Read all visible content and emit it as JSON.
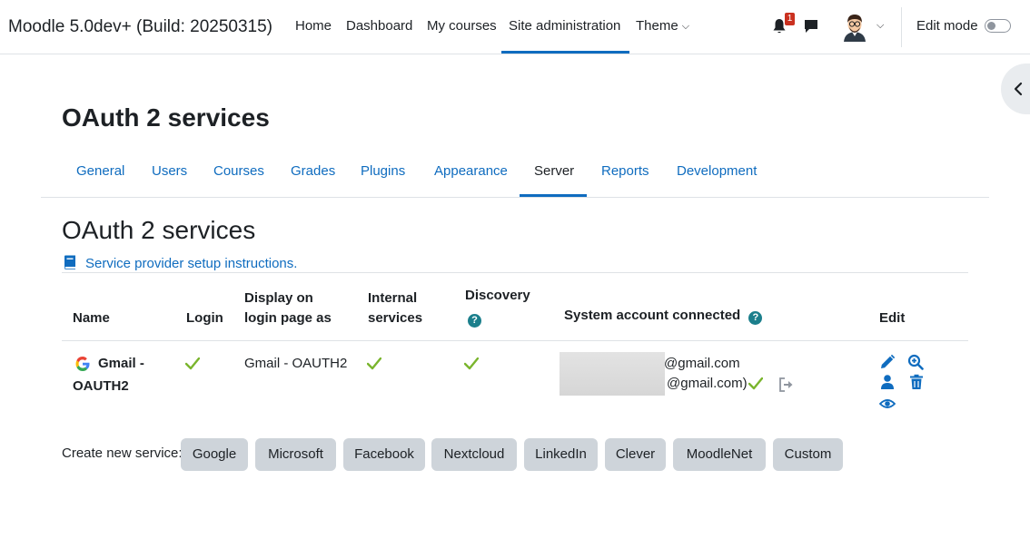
{
  "navbar": {
    "brand": "Moodle 5.0dev+ (Build: 20250315)",
    "links": [
      "Home",
      "Dashboard",
      "My courses",
      "Site administration",
      "Theme"
    ],
    "notification_count": "1",
    "edit_mode_label": "Edit mode",
    "edit_mode_on": false
  },
  "page": {
    "title": "OAuth 2 services",
    "tabs": [
      "General",
      "Users",
      "Courses",
      "Grades",
      "Plugins",
      "Appearance",
      "Server",
      "Reports",
      "Development"
    ],
    "active_tab": "Server",
    "section_title": "OAuth 2 services",
    "help_link": "Service provider setup instructions."
  },
  "table": {
    "headers": {
      "name": "Name",
      "login": "Login",
      "display_line1": "Display on",
      "display_line2": "login page as",
      "internal_line1": "Internal",
      "internal_line2": "services",
      "discovery": "Discovery",
      "system_account": "System account connected",
      "edit": "Edit"
    },
    "rows": [
      {
        "name_line1": "Gmail -",
        "name_line2": "OAUTH2",
        "login": true,
        "display_as": "Gmail - OAUTH2",
        "internal_services": true,
        "discovery": true,
        "account_line1": "@gmail.com",
        "account_line2": "@gmail.com)",
        "account_connected": true
      }
    ]
  },
  "create": {
    "label": "Create new service:",
    "buttons": [
      "Google",
      "Microsoft",
      "Facebook",
      "Nextcloud",
      "LinkedIn",
      "Clever",
      "MoodleNet",
      "Custom"
    ]
  },
  "colors": {
    "link": "#0f6cbf",
    "check": "#7ab52d",
    "info": "#1b7f8c",
    "badge": "#ca3120",
    "button_bg": "#ced4da"
  },
  "icons": {
    "notifications": "bell-icon",
    "messages": "chat-icon",
    "user_menu": "avatar",
    "drawer": "chevron-left-icon",
    "help": "book-icon",
    "provider": "google-icon",
    "edit": "pencil-icon",
    "review": "magnifier-plus-icon",
    "user_field_mappings": "user-icon",
    "delete": "trash-icon",
    "view": "eye-icon",
    "disconnect": "sign-out-icon"
  }
}
